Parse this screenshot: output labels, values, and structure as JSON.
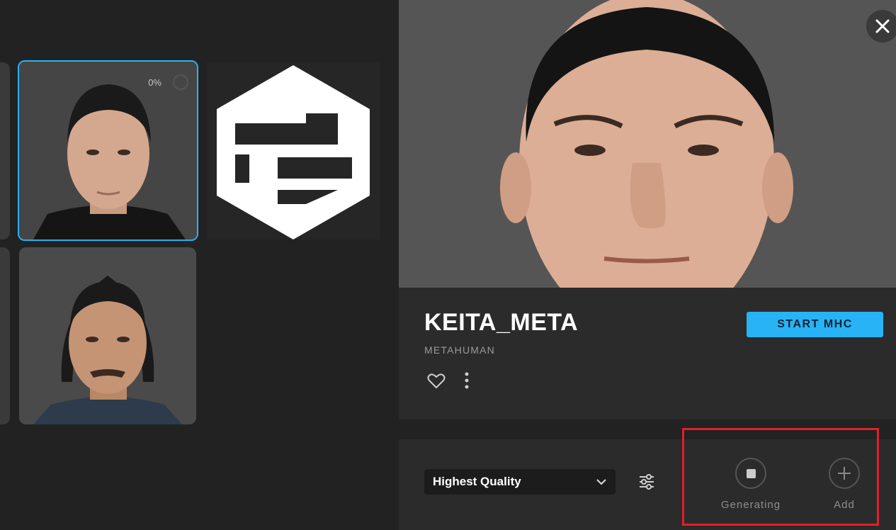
{
  "library": {
    "selected_tile": {
      "progress": "0%"
    }
  },
  "detail": {
    "name": "KEITA_META",
    "type": "METAHUMAN",
    "start_button": "START MHC",
    "favorite_icon": "heart-icon",
    "more_icon": "vertical-dots-icon",
    "close_icon": "close-icon"
  },
  "bottom": {
    "quality_selected": "Highest Quality",
    "settings_icon": "sliders-icon",
    "actions": [
      {
        "label": "Generating",
        "icon": "stop-icon"
      },
      {
        "label": "Add",
        "icon": "plus-icon"
      }
    ]
  },
  "colors": {
    "accent": "#27b3f5",
    "highlight_box": "#e0202a",
    "panel": "#2b2b2b"
  }
}
